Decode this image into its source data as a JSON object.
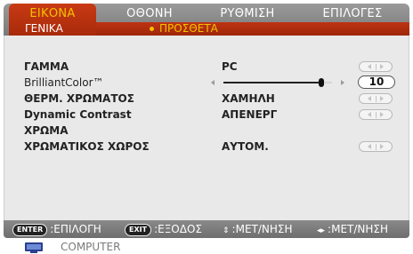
{
  "tabs": {
    "image": "ΕΙΚΟΝΑ",
    "display": "ΟΘΟΝΗ",
    "setup": "ΡΥΘΜΙΣΗ",
    "options": "ΕΠΙΛΟΓΕΣ"
  },
  "subtabs": {
    "general": "ΓΕΝΙΚΑ",
    "advanced": "ΠΡΟΣΘΕΤΑ"
  },
  "settings": [
    {
      "label": "ΓΑΜΜΑ",
      "value": "PC",
      "control": "arrows"
    },
    {
      "label": "BrilliantColor™",
      "value": "10",
      "control": "slider",
      "slider_fraction": 0.9
    },
    {
      "label": "ΘΕΡΜ. ΧΡΩΜΑΤΟΣ",
      "value": "ΧΑΜΗΛΗ",
      "control": "arrows"
    },
    {
      "label": "Dynamic Contrast",
      "value": "ΑΠΕΝΕΡΓ",
      "control": "arrows"
    },
    {
      "label": "ΧΡΩΜΑ",
      "value": "",
      "control": "none"
    },
    {
      "label": "ΧΡΩΜΑΤΙΚΟΣ ΧΩΡΟΣ",
      "value": "ΑΥΤΟΜ.",
      "control": "arrows"
    }
  ],
  "footer": {
    "enter_key": "ENTER",
    "enter_label": ":ΕΠΙΛΟΓΗ",
    "exit_key": "EXIT",
    "exit_label": ":ΕΞΟΔΟΣ",
    "updown_label": ":ΜΕΤ/ΝΗΣΗ",
    "leftright_label": ":ΜΕΤ/ΝΗΣΗ"
  },
  "source": {
    "label": "COMPUTER",
    "icon": "monitor-icon"
  },
  "colors": {
    "accent_tab": "#b8300e",
    "highlight_text": "#f3c200",
    "bar_gray": "#858585"
  }
}
